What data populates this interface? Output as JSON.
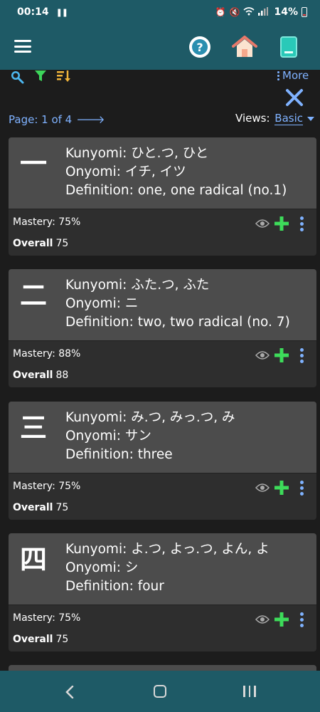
{
  "status_bar": {
    "time": "00:14",
    "battery": "14%"
  },
  "app_bar": {
    "menu_icon": "hamburger-menu-icon",
    "help_icon": "question-circle-icon",
    "home_icon": "home-icon",
    "book_icon": "book-icon"
  },
  "toolbar": {
    "more_label": "More",
    "pager_label": "Page: 1 of 4",
    "views_label": "Views:",
    "views_value": "Basic"
  },
  "cards": [
    {
      "kanji": "一",
      "kunyomi": "Kunyomi: ひと.つ, ひと",
      "onyomi": "Onyomi: イチ, イツ",
      "definition": "Definition: one, one radical (no.1)",
      "mastery": "Mastery: 75%",
      "overall_label": "Overall",
      "overall_value": "75"
    },
    {
      "kanji": "二",
      "kunyomi": "Kunyomi: ふた.つ, ふた",
      "onyomi": "Onyomi: ニ",
      "definition": "Definition: two, two radical (no. 7)",
      "mastery": "Mastery: 88%",
      "overall_label": "Overall",
      "overall_value": "88"
    },
    {
      "kanji": "三",
      "kunyomi": "Kunyomi: み.つ, みっ.つ, み",
      "onyomi": "Onyomi: サン",
      "definition": "Definition: three",
      "mastery": "Mastery: 75%",
      "overall_label": "Overall",
      "overall_value": "75"
    },
    {
      "kanji": "四",
      "kunyomi": "Kunyomi: よ.つ, よっ.つ, よん, よ",
      "onyomi": "Onyomi: シ",
      "definition": "Definition: four",
      "mastery": "Mastery: 75%",
      "overall_label": "Overall",
      "overall_value": "75"
    }
  ],
  "colors": {
    "app_bar": "#1e5a66",
    "accent_link": "#7fb2ff",
    "plus_green": "#3ddc5a",
    "card_top": "#4c4c4c",
    "card_bottom": "#2e2e2e"
  }
}
